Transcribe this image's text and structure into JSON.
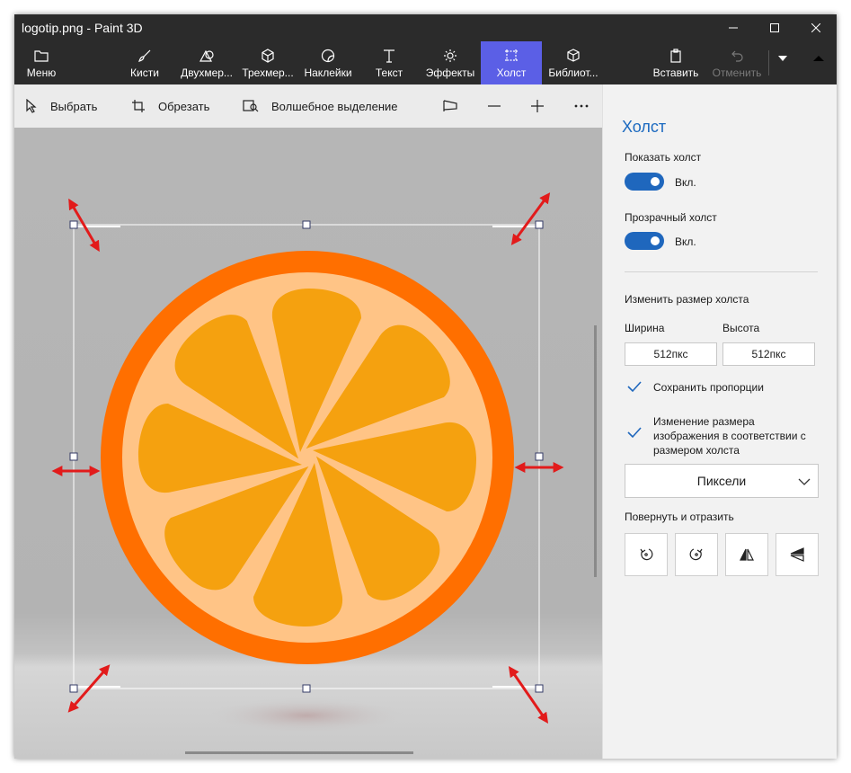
{
  "window": {
    "title": "logotip.png - Paint 3D"
  },
  "ribbon": {
    "menu_label": "Меню",
    "tabs": [
      {
        "label": "Кисти",
        "icon": "brush-icon"
      },
      {
        "label": "Двухмер...",
        "icon": "2d-shapes-icon"
      },
      {
        "label": "Трехмер...",
        "icon": "3d-shapes-icon"
      },
      {
        "label": "Наклейки",
        "icon": "stickers-icon"
      },
      {
        "label": "Текст",
        "icon": "text-icon"
      },
      {
        "label": "Эффекты",
        "icon": "effects-icon"
      },
      {
        "label": "Холст",
        "icon": "canvas-icon",
        "active": true
      },
      {
        "label": "Библиот...",
        "icon": "library-icon"
      }
    ],
    "paste_label": "Вставить",
    "undo_label": "Отменить",
    "active_color": "#5b5fe6"
  },
  "toolbar": {
    "select_label": "Выбрать",
    "crop_label": "Обрезать",
    "magic_select_label": "Волшебное выделение"
  },
  "panel": {
    "title": "Холст",
    "show_canvas_label": "Показать холст",
    "show_canvas_state": "Вкл.",
    "transparent_canvas_label": "Прозрачный холст",
    "transparent_canvas_state": "Вкл.",
    "resize_label": "Изменить размер холста",
    "width_label": "Ширина",
    "height_label": "Высота",
    "width_value": "512пкс",
    "height_value": "512пкс",
    "keep_ratio_label": "Сохранить пропорции",
    "resize_image_line1": "Изменение размера",
    "resize_image_line2": "изображения в соответствии с",
    "resize_image_line3": "размером холста",
    "units_value": "Пиксели",
    "rotate_label": "Повернуть и отразить",
    "accent_color": "#1f67bd"
  },
  "canvas": {
    "orange_peel_color": "#ff6f00",
    "orange_pith_color": "#ffc486",
    "orange_segment_color": "#f5a10f",
    "arrow_color": "#e21b1b"
  }
}
